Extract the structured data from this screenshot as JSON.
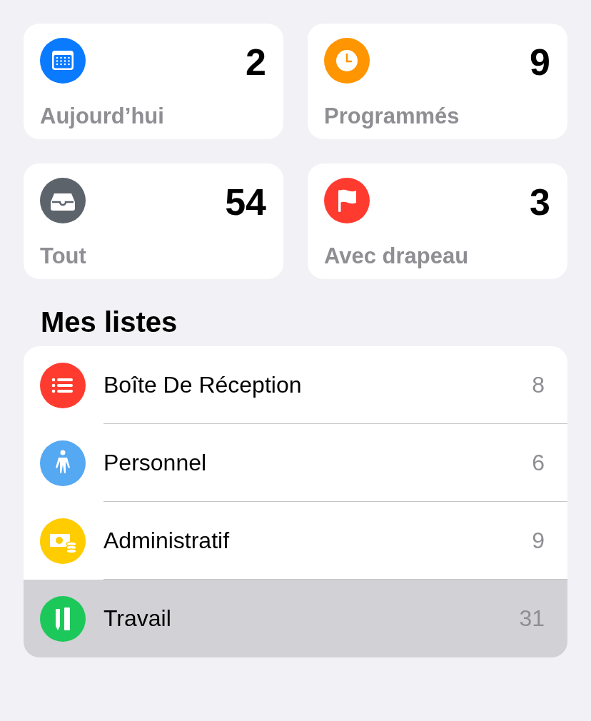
{
  "smart_lists": [
    {
      "kind": "calendar",
      "color": "#0a7aff",
      "label": "Aujourd’hui",
      "count": "2"
    },
    {
      "kind": "clock",
      "color": "#ff9500",
      "label": "Programmés",
      "count": "9"
    },
    {
      "kind": "tray",
      "color": "#5c636b",
      "label": "Tout",
      "count": "54"
    },
    {
      "kind": "flag",
      "color": "#ff3b30",
      "label": "Avec drapeau",
      "count": "3"
    }
  ],
  "my_lists": {
    "title": "Mes listes",
    "items": [
      {
        "kind": "list",
        "color": "#ff3b30",
        "name": "Boîte De Réception",
        "count": "8",
        "selected": false
      },
      {
        "kind": "person",
        "color": "#55a8f2",
        "name": "Personnel",
        "count": "6",
        "selected": false
      },
      {
        "kind": "money",
        "color": "#ffcc00",
        "name": "Administratif",
        "count": "9",
        "selected": false
      },
      {
        "kind": "pencil",
        "color": "#1dc85a",
        "name": "Travail",
        "count": "31",
        "selected": true
      }
    ]
  }
}
